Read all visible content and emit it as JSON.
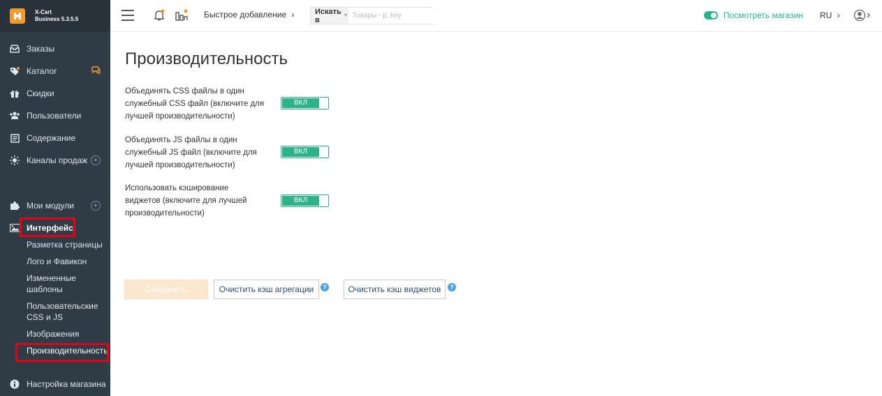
{
  "brand": {
    "line1": "X-Cart",
    "line2": "Business 5.3.5.5"
  },
  "sidebar": {
    "items": [
      {
        "label": "Заказы"
      },
      {
        "label": "Каталог"
      },
      {
        "label": "Скидки"
      },
      {
        "label": "Пользователи"
      },
      {
        "label": "Содержание"
      },
      {
        "label": "Каналы продаж"
      },
      {
        "label": "Мои модули"
      },
      {
        "label": "Интерфейс"
      },
      {
        "label": "Настройка магазина"
      }
    ],
    "interface_sub": [
      {
        "label": "Разметка страницы"
      },
      {
        "label": "Лого и Фавикон"
      },
      {
        "label": "Измененные шаблоны"
      },
      {
        "label": "Пользовательские CSS и JS"
      },
      {
        "label": "Изображения"
      },
      {
        "label": "Производительность"
      }
    ]
  },
  "header": {
    "quick_add": "Быстрое добавление",
    "search_label": "Искать в",
    "search_placeholder": "Товары - p: key",
    "view_store": "Посмотреть магазин",
    "lang": "RU"
  },
  "main": {
    "title": "Производительность",
    "settings": [
      {
        "label": "Объединять CSS файлы в один служебный CSS файл (включите для лучшей производительности)",
        "state": "ВКЛ"
      },
      {
        "label": "Объединять JS файлы в один служебный JS файл (включите для лучшей производительности)",
        "state": "ВКЛ"
      },
      {
        "label": "Использовать кэширование виджетов (включите для лучшей производительности)",
        "state": "ВКЛ"
      }
    ],
    "buttons": {
      "save": "Сохранить",
      "clear_aggregation": "Очистить кэш агрегации",
      "clear_widgets": "Очистить кэш виджетов",
      "help": "?"
    }
  },
  "colors": {
    "accent": "#2bb586",
    "sidebar_bg": "#2f3b45",
    "brand": "#f39a2d",
    "highlight": "#e3001b"
  }
}
